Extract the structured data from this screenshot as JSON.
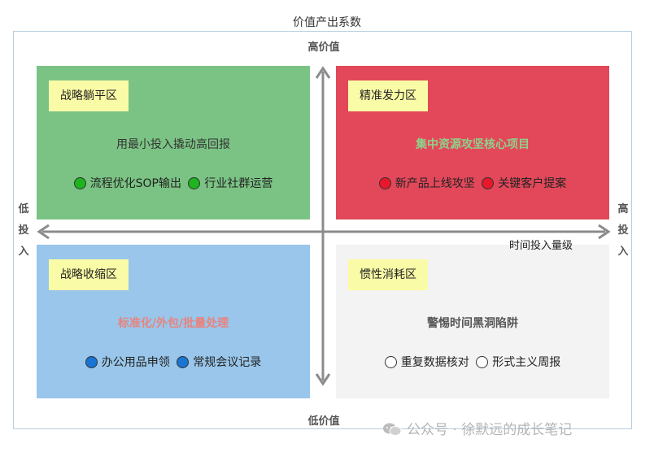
{
  "title": "价值产出系数",
  "axes": {
    "y_top": "高价值",
    "y_bottom": "低价值",
    "x_left": [
      "低",
      "投",
      "入"
    ],
    "x_right": [
      "高",
      "投",
      "入"
    ],
    "x_caption": "时间投入量级"
  },
  "quadrants": {
    "top_left": {
      "tag": "战略躺平区",
      "subtitle": "用最小投入撬动高回报",
      "subtitle_color": "#333333",
      "items": [
        {
          "label": "流程优化SOP输出",
          "dot_color": "#1db41d"
        },
        {
          "label": "行业社群运营",
          "dot_color": "#1db41d"
        }
      ]
    },
    "top_right": {
      "tag": "精准发力区",
      "subtitle": "集中资源攻坚核心项目",
      "subtitle_color": "#8fd18a",
      "items": [
        {
          "label": "新产品上线攻坚",
          "dot_color": "#e8172b"
        },
        {
          "label": "关键客户提案",
          "dot_color": "#e8172b"
        }
      ]
    },
    "bottom_left": {
      "tag": "战略收缩区",
      "subtitle": "标准化/外包/批量处理",
      "subtitle_color": "#e8837f",
      "items": [
        {
          "label": "办公用品申领",
          "dot_color": "#1a74d2"
        },
        {
          "label": "常规会议记录",
          "dot_color": "#1a74d2"
        }
      ]
    },
    "bottom_right": {
      "tag": "惯性消耗区",
      "subtitle": "警惕时间黑洞陷阱",
      "subtitle_color": "#555555",
      "items": [
        {
          "label": "重复数据核对",
          "dot_color": "#ffffff"
        },
        {
          "label": "形式主义周报",
          "dot_color": "#ffffff"
        }
      ]
    }
  },
  "watermark": "公众号 · 徐默远的成长笔记",
  "watermark_icon": "wechat-icon"
}
